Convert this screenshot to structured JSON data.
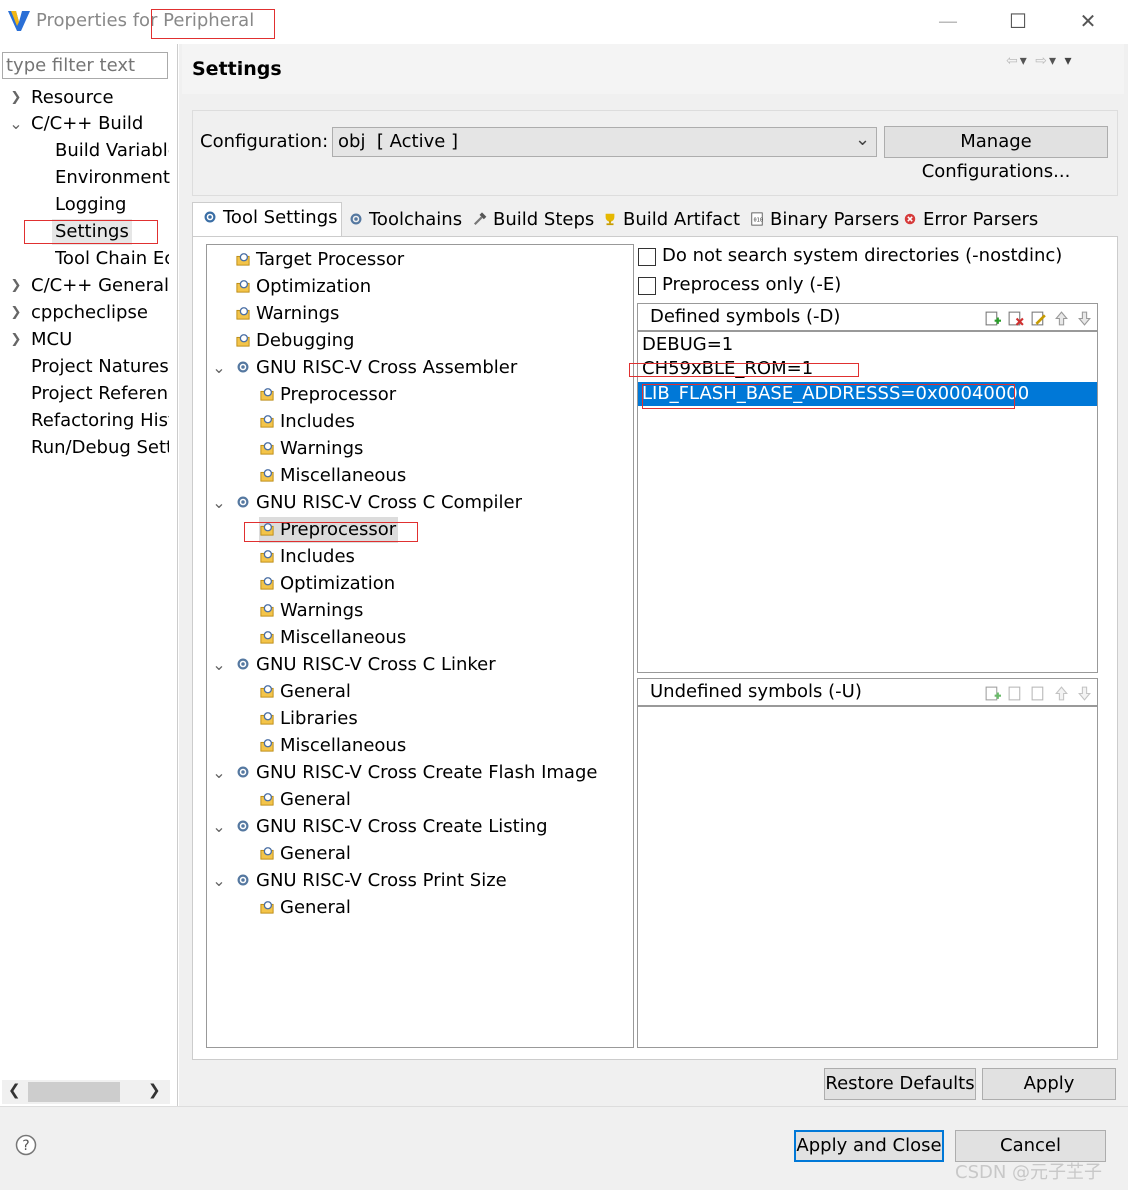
{
  "window": {
    "title_prefix": "Properties for ",
    "title_project": "Peripheral"
  },
  "filter": {
    "placeholder": "type filter text"
  },
  "nav": [
    {
      "label": "Resource",
      "chev": "›"
    },
    {
      "label": "C/C++ Build",
      "chev": "⌄"
    },
    {
      "label": "Build Variable"
    },
    {
      "label": "Environment"
    },
    {
      "label": "Logging"
    },
    {
      "label": "Settings"
    },
    {
      "label": "Tool Chain Ec"
    },
    {
      "label": "C/C++ General",
      "chev": "›"
    },
    {
      "label": "cppcheclipse",
      "chev": "›"
    },
    {
      "label": "MCU",
      "chev": "›"
    },
    {
      "label": "Project Natures"
    },
    {
      "label": "Project Referenc"
    },
    {
      "label": "Refactoring Hist"
    },
    {
      "label": "Run/Debug Sett"
    }
  ],
  "settings_title": "Settings",
  "config": {
    "label": "Configuration:",
    "value": "obj  [ Active ]",
    "manage_label": "Manage Configurations..."
  },
  "tabs": [
    "Tool Settings",
    "Toolchains",
    "Build Steps",
    "Build Artifact",
    "Binary Parsers",
    "Error Parsers"
  ],
  "tree": [
    {
      "label": "Target Processor"
    },
    {
      "label": "Optimization"
    },
    {
      "label": "Warnings"
    },
    {
      "label": "Debugging"
    },
    {
      "label": "GNU RISC-V Cross Assembler",
      "group": true
    },
    {
      "label": "Preprocessor"
    },
    {
      "label": "Includes"
    },
    {
      "label": "Warnings"
    },
    {
      "label": "Miscellaneous"
    },
    {
      "label": "GNU RISC-V Cross C Compiler",
      "group": true
    },
    {
      "label": "Preprocessor"
    },
    {
      "label": "Includes"
    },
    {
      "label": "Optimization"
    },
    {
      "label": "Warnings"
    },
    {
      "label": "Miscellaneous"
    },
    {
      "label": "GNU RISC-V Cross C Linker",
      "group": true
    },
    {
      "label": "General"
    },
    {
      "label": "Libraries"
    },
    {
      "label": "Miscellaneous"
    },
    {
      "label": "GNU RISC-V Cross Create Flash Image",
      "group": true
    },
    {
      "label": "General"
    },
    {
      "label": "GNU RISC-V Cross Create Listing",
      "group": true
    },
    {
      "label": "General"
    },
    {
      "label": "GNU RISC-V Cross Print Size",
      "group": true
    },
    {
      "label": "General"
    }
  ],
  "options": {
    "nostdinc": "Do not search system directories (-nostdinc)",
    "preprocess_only": "Preprocess only (-E)"
  },
  "defined": {
    "title": "Defined symbols (-D)",
    "items": [
      "DEBUG=1",
      "CH59xBLE_ROM=1",
      "LIB_FLASH_BASE_ADDRESSS=0x00040000"
    ]
  },
  "undefined": {
    "title": "Undefined symbols (-U)"
  },
  "buttons": {
    "restore": "Restore Defaults",
    "apply": "Apply",
    "apply_close": "Apply and Close",
    "cancel": "Cancel"
  },
  "watermark": "CSDN @元子芏子",
  "colors": {
    "selection": "#0078d7",
    "highlight_box": "#e03030"
  }
}
